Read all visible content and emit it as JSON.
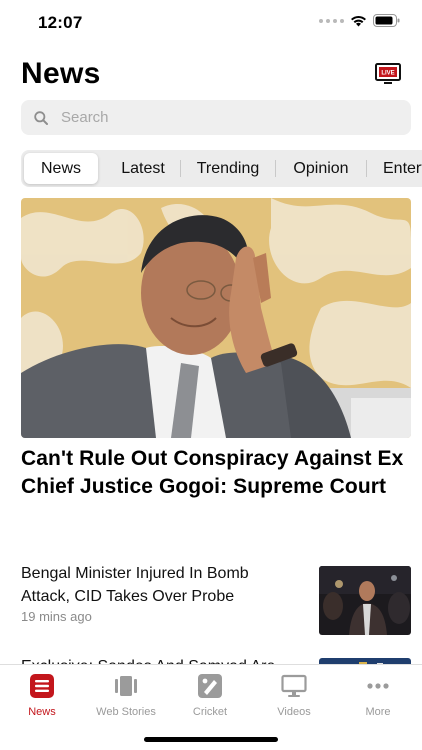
{
  "status_bar": {
    "time": "12:07"
  },
  "header": {
    "title": "News",
    "live_badge": "LIVE",
    "live_icon": "live-tv-icon"
  },
  "search": {
    "placeholder": "Search"
  },
  "tabs": [
    {
      "label": "News",
      "active": true
    },
    {
      "label": "Latest",
      "active": false
    },
    {
      "label": "Trending",
      "active": false
    },
    {
      "label": "Opinion",
      "active": false
    },
    {
      "label": "Enterta",
      "active": false
    }
  ],
  "hero": {
    "title": "Can't Rule Out Conspiracy Against Ex Chief Justice Gogoi: Supreme Court"
  },
  "stories": [
    {
      "title": "Bengal Minister Injured In Bomb Attack, CID Takes Over Probe",
      "time": "19 mins ago"
    },
    {
      "title": "Exclusive: Sandes And Samvad Are",
      "time": ""
    }
  ],
  "tab_bar": [
    {
      "label": "News",
      "icon": "news-icon",
      "active": true
    },
    {
      "label": "Web Stories",
      "icon": "web-stories-icon",
      "active": false
    },
    {
      "label": "Cricket",
      "icon": "cricket-icon",
      "active": false
    },
    {
      "label": "Videos",
      "icon": "videos-icon",
      "active": false
    },
    {
      "label": "More",
      "icon": "more-icon",
      "active": false
    }
  ],
  "colors": {
    "accent": "#c3161c",
    "inactive": "#9a9a9a",
    "search_bg": "#efefef",
    "tabs_bg": "#ececec"
  }
}
